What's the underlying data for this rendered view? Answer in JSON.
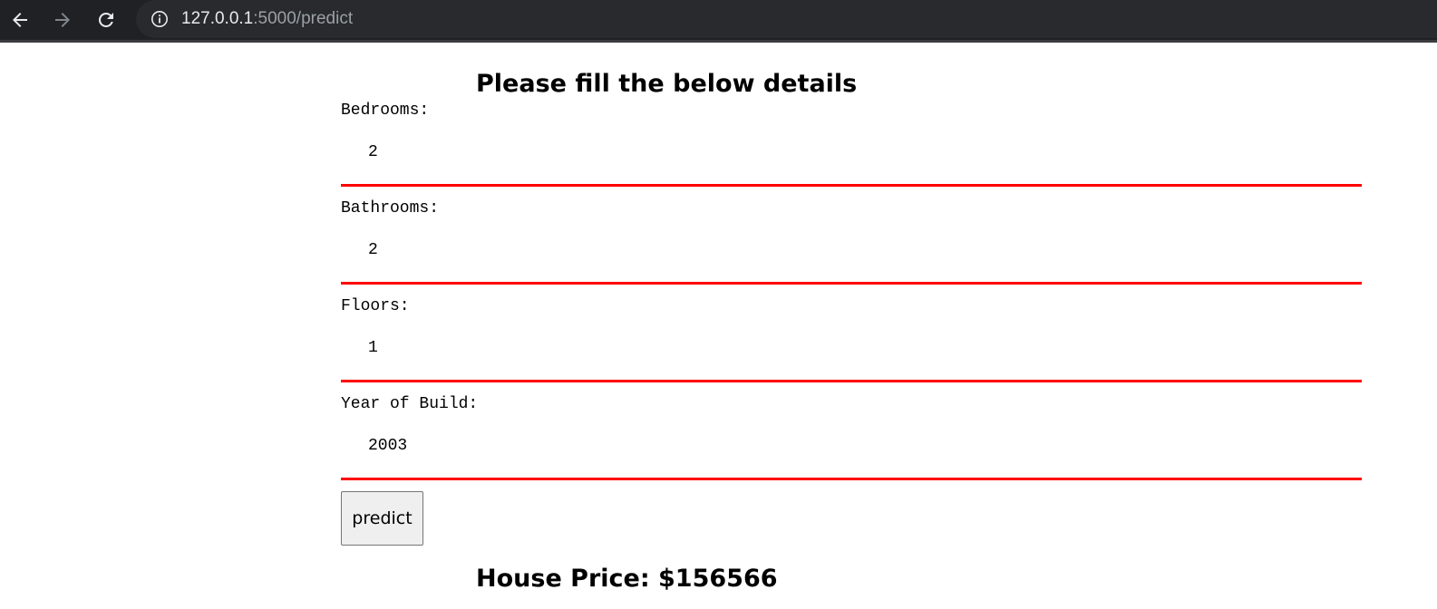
{
  "browser": {
    "url_host": "127.0.0.1",
    "url_path": ":5000/predict",
    "icons": [
      "back-arrow-icon",
      "forward-arrow-icon",
      "reload-icon",
      "info-icon"
    ]
  },
  "page": {
    "heading": "Please fill the below details",
    "fields": [
      {
        "label": "Bedrooms:",
        "value": "2"
      },
      {
        "label": "Bathrooms:",
        "value": "2"
      },
      {
        "label": "Floors:",
        "value": "1"
      },
      {
        "label": "Year of Build:",
        "value": "2003"
      }
    ],
    "predict_label": "predict",
    "result": "House Price: $156566"
  },
  "colors": {
    "input_underline": "#ff0000",
    "toolbar_bg": "#202124"
  }
}
